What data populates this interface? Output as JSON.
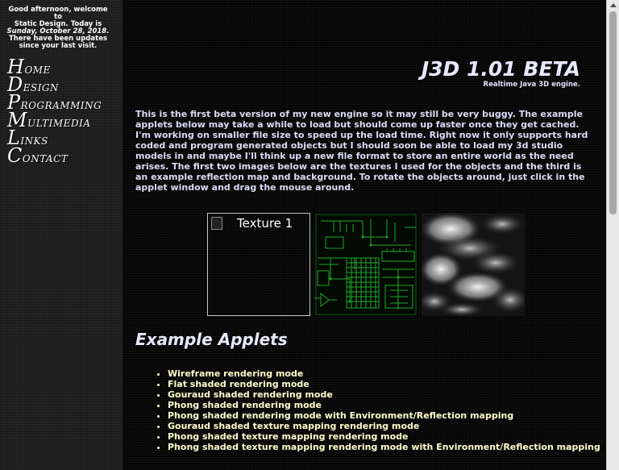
{
  "sidebar": {
    "welcome": {
      "line1": "Good afternoon, welcome to",
      "line2": "Static Design. Today is",
      "date": "Sunday, October 28, 2018.",
      "line3": "There have been updates",
      "line4": "since your last visit."
    },
    "nav": [
      {
        "cap": "H",
        "rest": "ome"
      },
      {
        "cap": "D",
        "rest": "esign"
      },
      {
        "cap": "P",
        "rest": "rogramming"
      },
      {
        "cap": "M",
        "rest": "ultimedia"
      },
      {
        "cap": "L",
        "rest": "inks"
      },
      {
        "cap": "C",
        "rest": "ontact"
      }
    ]
  },
  "header": {
    "title": "J3D 1.01 BETA",
    "subtitle": "Realtime Java 3D engine."
  },
  "main": {
    "intro": "This is the first beta version of my new engine so it may still be very buggy. The example applets below may take a while to load but should come up faster once they get cached. I'm working on smaller file size to speed up the load time. Right now it only supports hard coded and program generated objects but I should soon be able to load my 3d studio models in and maybe I'll think up a new file format to store an entire world as the need arises. The first two images below are the textures I used for the objects and the third is an example reflection map and background. To rotate the objects around, just click in the applet window and drag the mouse around.",
    "images": {
      "texture1_alt": "Texture 1"
    },
    "applets_heading": "Example Applets",
    "applets": [
      "Wireframe rendering mode",
      "Flat shaded rendering mode",
      "Gouraud shaded rendering mode",
      "Phong shaded rendering mode",
      "Phong shaded rendering mode with Environment/Reflection mapping",
      "Gouraud shaded texture mapping rendering mode",
      "Phong shaded texture mapping rendering mode",
      "Phong shaded texture mapping rendering mode with Environment/Reflection mapping"
    ]
  },
  "colors": {
    "background": "#050505",
    "sidebar": "#1b1b1b",
    "text": "#dcdcf8",
    "list_text": "#ffffcc",
    "circuit_green": "#1fa82a"
  }
}
